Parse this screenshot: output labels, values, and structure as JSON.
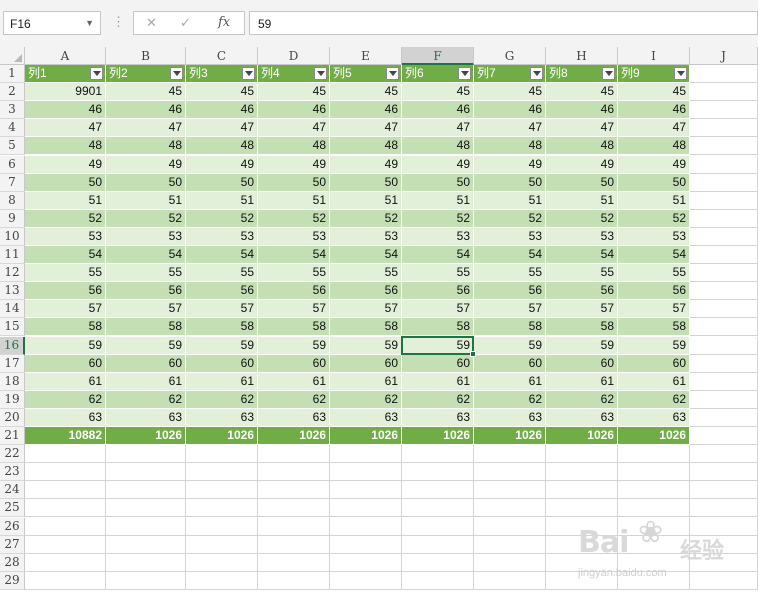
{
  "formula_bar": {
    "name_box": "F16",
    "formula": "59",
    "fx_label": "fx",
    "cancel_icon": "✕",
    "enter_icon": "✓",
    "dots": "⋮"
  },
  "columns": [
    "A",
    "B",
    "C",
    "D",
    "E",
    "F",
    "G",
    "H",
    "I",
    "J"
  ],
  "selected_column": "F",
  "selected_row": 16,
  "row_numbers": [
    1,
    2,
    3,
    4,
    5,
    6,
    7,
    8,
    9,
    10,
    11,
    12,
    13,
    14,
    15,
    16,
    17,
    18,
    19,
    20,
    21,
    22,
    23,
    24,
    25,
    26,
    27,
    28,
    29
  ],
  "table": {
    "headers": [
      "列1",
      "列2",
      "列3",
      "列4",
      "列5",
      "列6",
      "列7",
      "列8",
      "列9"
    ],
    "rows": [
      [
        "9901",
        "45",
        "45",
        "45",
        "45",
        "45",
        "45",
        "45",
        "45"
      ],
      [
        "46",
        "46",
        "46",
        "46",
        "46",
        "46",
        "46",
        "46",
        "46"
      ],
      [
        "47",
        "47",
        "47",
        "47",
        "47",
        "47",
        "47",
        "47",
        "47"
      ],
      [
        "48",
        "48",
        "48",
        "48",
        "48",
        "48",
        "48",
        "48",
        "48"
      ],
      [
        "49",
        "49",
        "49",
        "49",
        "49",
        "49",
        "49",
        "49",
        "49"
      ],
      [
        "50",
        "50",
        "50",
        "50",
        "50",
        "50",
        "50",
        "50",
        "50"
      ],
      [
        "51",
        "51",
        "51",
        "51",
        "51",
        "51",
        "51",
        "51",
        "51"
      ],
      [
        "52",
        "52",
        "52",
        "52",
        "52",
        "52",
        "52",
        "52",
        "52"
      ],
      [
        "53",
        "53",
        "53",
        "53",
        "53",
        "53",
        "53",
        "53",
        "53"
      ],
      [
        "54",
        "54",
        "54",
        "54",
        "54",
        "54",
        "54",
        "54",
        "54"
      ],
      [
        "55",
        "55",
        "55",
        "55",
        "55",
        "55",
        "55",
        "55",
        "55"
      ],
      [
        "56",
        "56",
        "56",
        "56",
        "56",
        "56",
        "56",
        "56",
        "56"
      ],
      [
        "57",
        "57",
        "57",
        "57",
        "57",
        "57",
        "57",
        "57",
        "57"
      ],
      [
        "58",
        "58",
        "58",
        "58",
        "58",
        "58",
        "58",
        "58",
        "58"
      ],
      [
        "59",
        "59",
        "59",
        "59",
        "59",
        "59",
        "59",
        "59",
        "59"
      ],
      [
        "60",
        "60",
        "60",
        "60",
        "60",
        "60",
        "60",
        "60",
        "60"
      ],
      [
        "61",
        "61",
        "61",
        "61",
        "61",
        "61",
        "61",
        "61",
        "61"
      ],
      [
        "62",
        "62",
        "62",
        "62",
        "62",
        "62",
        "62",
        "62",
        "62"
      ],
      [
        "63",
        "63",
        "63",
        "63",
        "63",
        "63",
        "63",
        "63",
        "63"
      ]
    ],
    "totals": [
      "10882",
      "1026",
      "1026",
      "1026",
      "1026",
      "1026",
      "1026",
      "1026",
      "1026"
    ]
  },
  "colors": {
    "header_fill": "#70ad47",
    "band_dark": "#c5dfb4",
    "band_light": "#e2efd9",
    "selection": "#217346"
  },
  "watermark": {
    "logo": "Bai",
    "suffix": "经验",
    "url": "jingyan.baidu.com",
    "icon": "paw-icon"
  }
}
